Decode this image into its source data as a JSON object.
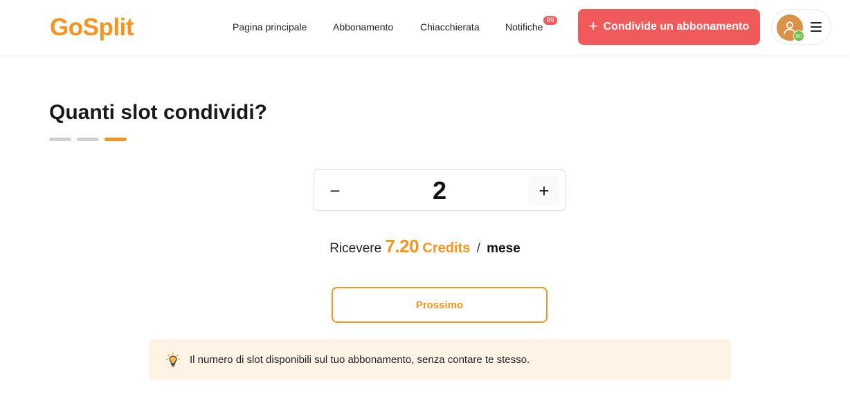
{
  "header": {
    "logo": "GoSplit",
    "nav": {
      "home": "Pagina principale",
      "subscription": "Abbonamento",
      "chat": "Chiacchierata",
      "notifications": "Notifiche",
      "notifications_count": "99"
    },
    "share_button": {
      "icon": "+",
      "label": "Condivide un abbonamento"
    },
    "profile": {
      "level": "60",
      "icon": "user-icon",
      "menu_icon": "hamburger-menu-icon"
    }
  },
  "main": {
    "title": "Quanti slot condividi?",
    "progress": {
      "total_steps": 3,
      "current_step": 3
    },
    "stepper": {
      "minus": "−",
      "value": "2",
      "plus": "+"
    },
    "receive": {
      "prefix": "Ricevere",
      "amount": "7.20",
      "unit": "Credits",
      "separator": "/",
      "period": "mese"
    },
    "next_button": "Prossimo",
    "tip": {
      "icon": "lightbulb-icon",
      "text": "Il numero di slot disponibili sul tuo abbonamento, senza contare te stesso."
    }
  },
  "colors": {
    "brand_orange": "#F7941D",
    "accent_red": "#F05A5A",
    "tip_background": "#FFF3E6",
    "level_green": "#6BBF45"
  }
}
